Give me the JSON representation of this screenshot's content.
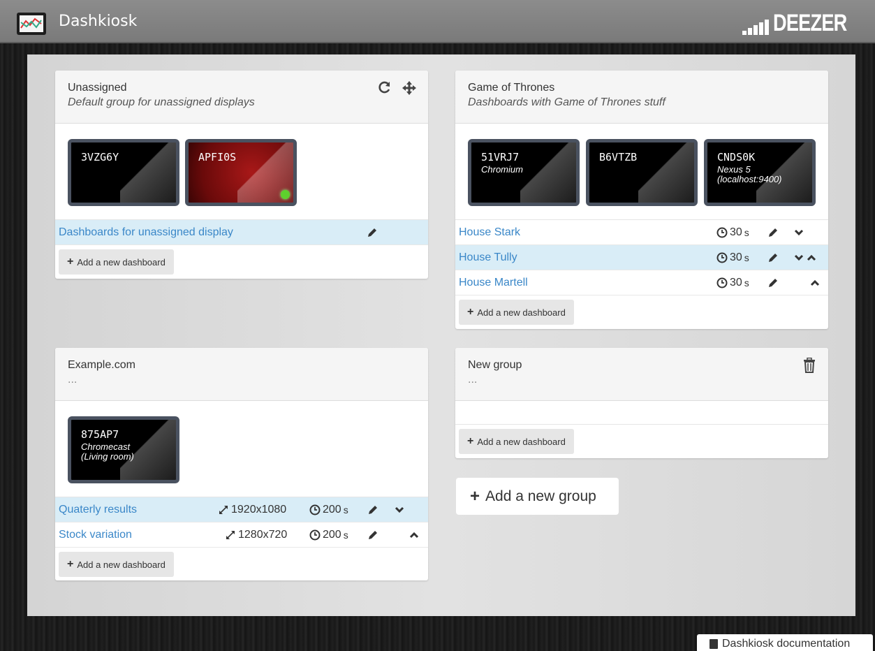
{
  "app": {
    "title": "Dashkiosk",
    "brand": "DEEZER"
  },
  "groups": [
    {
      "title": "Unassigned",
      "description": "Default group for unassigned displays",
      "displays": [
        {
          "name": "3VZG6Y",
          "desc": ""
        },
        {
          "name": "APFI0S",
          "desc": "",
          "online": true
        }
      ],
      "dashboards": [
        {
          "label": "Dashboards for unassigned display"
        }
      ],
      "add_label": "Add a new dashboard"
    },
    {
      "title": "Game of Thrones",
      "description": "Dashboards with Game of Thrones stuff",
      "displays": [
        {
          "name": "51VRJ7",
          "desc": "Chromium"
        },
        {
          "name": "B6VTZB",
          "desc": ""
        },
        {
          "name": "CNDS0K",
          "desc": "Nexus 5 (localhost:9400)"
        }
      ],
      "dashboards": [
        {
          "label": "House Stark",
          "timeout": "30",
          "unit": "s"
        },
        {
          "label": "House Tully",
          "timeout": "30",
          "unit": "s"
        },
        {
          "label": "House Martell",
          "timeout": "30",
          "unit": "s"
        }
      ],
      "add_label": "Add a new dashboard"
    },
    {
      "title": "Example.com",
      "description": "...",
      "displays": [
        {
          "name": "875AP7",
          "desc": "Chromecast (Living room)"
        }
      ],
      "dashboards": [
        {
          "label": "Quaterly results",
          "viewport": "1920x1080",
          "timeout": "200",
          "unit": "s"
        },
        {
          "label": "Stock variation",
          "viewport": "1280x720",
          "timeout": "200",
          "unit": "s"
        }
      ],
      "add_label": "Add a new dashboard"
    },
    {
      "title": "New group",
      "description": "...",
      "displays": [],
      "dashboards": [],
      "add_label": "Add a new dashboard"
    }
  ],
  "add_group_label": "Add a new group",
  "docs_label": "Dashkiosk documentation",
  "icons": {
    "refresh": "refresh-icon",
    "move": "move-icon",
    "pencil": "pencil-icon",
    "clock": "clock-icon",
    "chevron_down": "chevron-down-icon",
    "chevron_up": "chevron-up-icon",
    "resize": "resize-icon",
    "trash": "trash-icon",
    "plus": "plus-icon",
    "book": "book-icon"
  },
  "colors": {
    "link": "#3a87c8",
    "highlight": "#d9edf7",
    "online": "#5ed12d"
  }
}
